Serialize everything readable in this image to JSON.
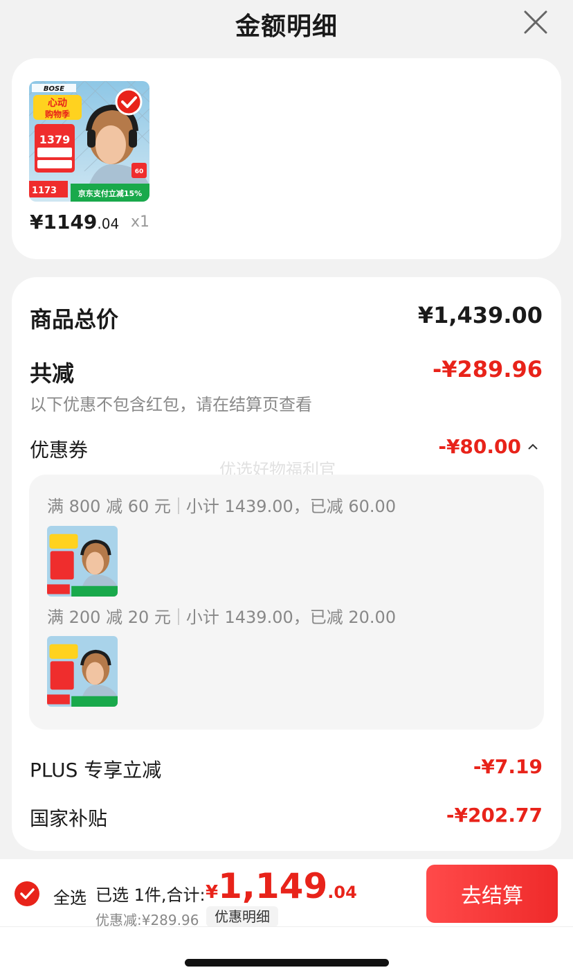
{
  "header": {
    "title": "金额明细"
  },
  "product": {
    "image": {
      "brand": "BOSE",
      "promo_title": "心动购物季",
      "price_tag": "1379",
      "sub_price": "1173",
      "pay_promo": "京东支付立减15%",
      "badge_discount": "60"
    },
    "price_main": "¥1149",
    "price_cents": ".04",
    "quantity": "x1"
  },
  "summary": {
    "total_label": "商品总价",
    "total_value": "¥1,439.00",
    "discount_label": "共减",
    "discount_value": "-¥289.96",
    "discount_note": "以下优惠不包含红包，请在结算页查看",
    "coupon_label": "优惠券",
    "coupon_value": "-¥80.00",
    "coupons": [
      {
        "rule": "满 800 减 60 元",
        "detail": "小计 1439.00，已减 60.00"
      },
      {
        "rule": "满 200 减 20 元",
        "detail": "小计 1439.00，已减 20.00"
      }
    ],
    "plus_label": "PLUS 专享立减",
    "plus_value": "-¥7.19",
    "subsidy_label": "国家补贴",
    "subsidy_value": "-¥202.77",
    "watermark": "优选好物福利官"
  },
  "bottom": {
    "select_all": "全选",
    "selected_text": "已选 1件,合计:",
    "total_yen": "¥",
    "total_int": "1,149",
    "total_dec": ".04",
    "discount_text": "优惠减:¥289.96",
    "detail_chip": "优惠明细",
    "checkout": "去结算"
  },
  "colors": {
    "accent": "#e8231a",
    "background": "#f2f2f2"
  }
}
